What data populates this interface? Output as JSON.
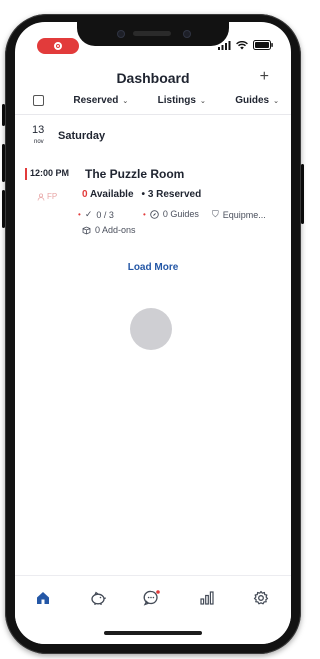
{
  "header": {
    "title": "Dashboard",
    "add_label": "+"
  },
  "filters": [
    {
      "label": "Reserved"
    },
    {
      "label": "Listings"
    },
    {
      "label": "Guides"
    }
  ],
  "date": {
    "day_number": "13",
    "month": "nov",
    "weekday": "Saturday"
  },
  "event": {
    "time": "12:00 PM",
    "badge": "FP",
    "title": "The Puzzle Room",
    "available_count": "0",
    "available_label": "Available",
    "reserved_text": "3 Reserved",
    "checkins": "0 / 3",
    "guides": "0 Guides",
    "equipment": "Equipme...",
    "addons": "0 Add-ons"
  },
  "load_more": "Load More",
  "colors": {
    "accent": "#e23b3b",
    "link": "#2457a6",
    "active_tab": "#2457a6",
    "inactive_tab": "#444b57"
  },
  "tabs": [
    {
      "icon": "home-icon",
      "active": true
    },
    {
      "icon": "piggy-bank-icon",
      "active": false
    },
    {
      "icon": "chat-icon",
      "active": false
    },
    {
      "icon": "bar-chart-icon",
      "active": false
    },
    {
      "icon": "gear-icon",
      "active": false
    }
  ]
}
